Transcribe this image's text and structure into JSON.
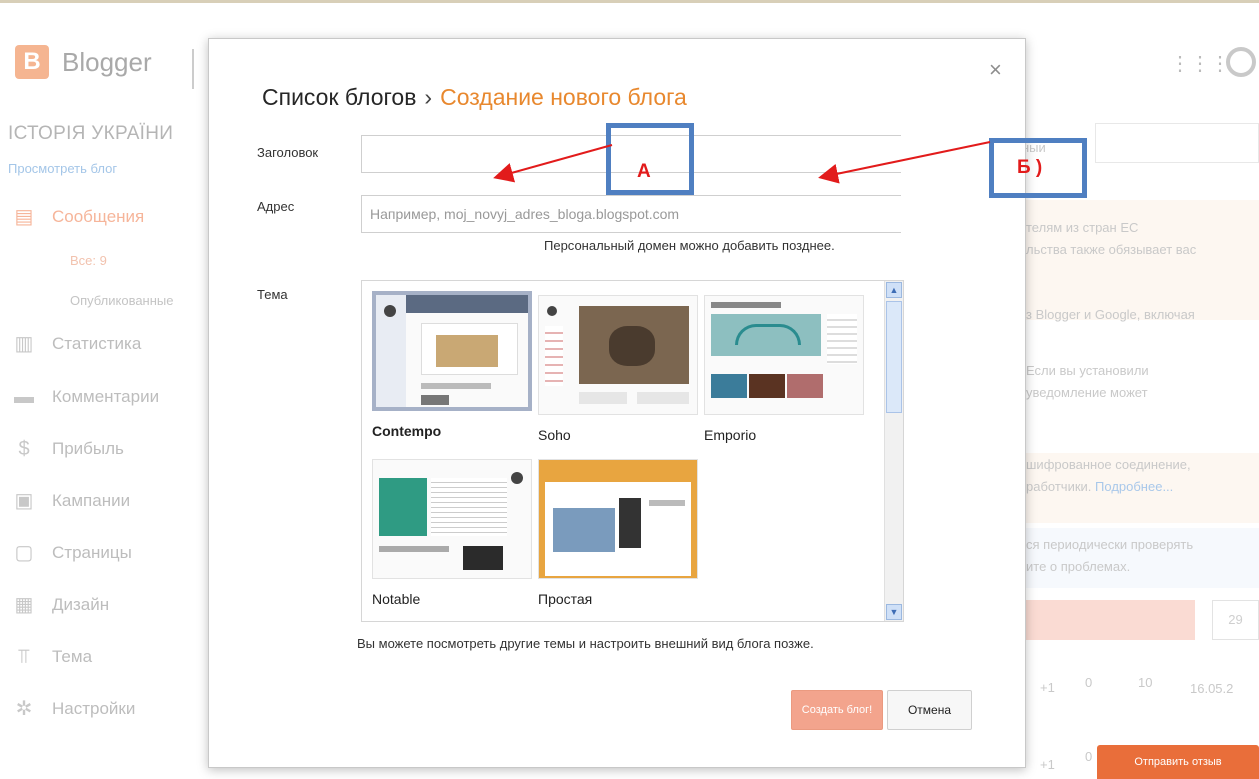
{
  "app": {
    "brand": "Blogger",
    "logo_letter": "B",
    "blog_name": "ІСТОРІЯ УКРАЇНИ",
    "view_blog": "Просмотреть блог"
  },
  "sidebar": {
    "items": [
      {
        "label": "Сообщения",
        "icon": "posts-icon",
        "active": true
      },
      {
        "label": "Статистика",
        "icon": "stats-icon"
      },
      {
        "label": "Комментарии",
        "icon": "comments-icon"
      },
      {
        "label": "Прибыль",
        "icon": "earnings-icon"
      },
      {
        "label": "Кампании",
        "icon": "campaigns-icon"
      },
      {
        "label": "Страницы",
        "icon": "pages-icon"
      },
      {
        "label": "Дизайн",
        "icon": "layout-icon"
      },
      {
        "label": "Тема",
        "icon": "theme-icon"
      },
      {
        "label": "Настройки",
        "icon": "settings-icon"
      }
    ],
    "sub_items": [
      "Все: 9",
      "Опубликованные"
    ]
  },
  "right_panel": {
    "dropdown_fragment": "ныи",
    "notice_1": [
      "телям из стран ЕС",
      "льства также обязывает вас"
    ],
    "notice_2": "з Blogger и Google, включая",
    "notice_3": [
      "Если вы установили",
      "уведомление может"
    ],
    "notice_4": [
      "шифрованное соединение,",
      "работчики."
    ],
    "notice_4_link": "Подробнее...",
    "notice_5": [
      "ся периодически проверять",
      "ите о проблемах."
    ],
    "box_value": "29",
    "stats_row_1": [
      "+1",
      "0",
      "10",
      "16.05.2"
    ],
    "stats_row_2": [
      "+1",
      "0"
    ],
    "feedback_button": "Отправить отзыв"
  },
  "dialog": {
    "breadcrumb_parent": "Список блогов",
    "breadcrumb_separator": "›",
    "breadcrumb_current": "Создание нового блога",
    "close_label": "×",
    "title_label": "Заголовок",
    "title_value": "",
    "address_label": "Адрес",
    "address_placeholder": "Например, moj_novyj_adres_bloga.blogspot.com",
    "domain_hint": "Персональный домен можно добавить позднее.",
    "theme_label": "Тема",
    "themes": [
      {
        "name": "Contempo",
        "selected": true
      },
      {
        "name": "Soho"
      },
      {
        "name": "Emporio"
      },
      {
        "name": "Notable"
      },
      {
        "name": "Простая"
      }
    ],
    "later_hint": "Вы можете посмотреть другие темы и настроить внешний вид блога позже.",
    "create_button": "Создать блог!",
    "cancel_button": "Отмена"
  },
  "annotations": {
    "label_a": "А",
    "label_b": "Б )",
    "arrow_color": "#e21b1b",
    "box_color": "#4f7fc1"
  }
}
